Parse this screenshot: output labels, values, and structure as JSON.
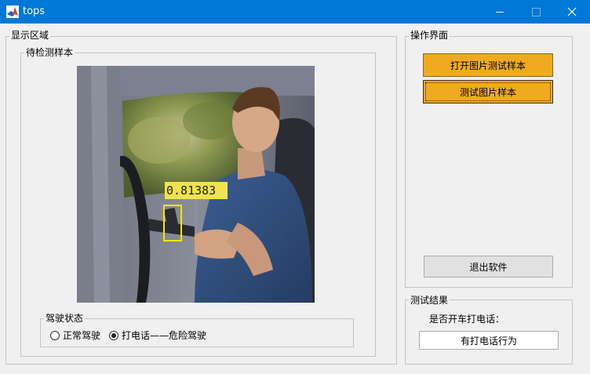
{
  "window": {
    "title": "tops"
  },
  "display_area": {
    "label": "显示区域",
    "sample_panel": {
      "label": "待检测样本",
      "detection": {
        "score": "0.81383"
      }
    },
    "driving_state": {
      "label": "驾驶状态",
      "options": [
        "正常驾驶",
        "打电话——危险驾驶"
      ],
      "selected": 1
    }
  },
  "operation_panel": {
    "label": "操作界面",
    "open_button": "打开图片测试样本",
    "test_button": "测试图片样本",
    "exit_button": "退出软件"
  },
  "result_panel": {
    "label": "测试结果",
    "question": "是否开车打电话：",
    "answer": "有打电话行为"
  },
  "colors": {
    "titlebar": "#0078d7",
    "button_accent": "#f0aa1f",
    "detection": "#f5e600"
  }
}
